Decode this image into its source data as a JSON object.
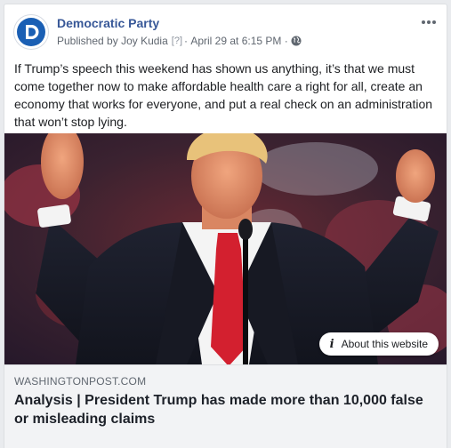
{
  "post": {
    "page_name": "Democratic Party",
    "published_prefix": "Published by",
    "author": "Joy Kudia",
    "help_marker": "[?]",
    "separator": "·",
    "timestamp": "April 29 at 6:15 PM",
    "audience_icon": "globe-icon",
    "more_icon": "more-options-icon",
    "text": "If Trump’s speech this weekend has shown us anything, it’s that we must come together now to make affordable health care a right for all, create an economy that works for everyone, and put a real check on an administration that won’t stop lying."
  },
  "link_preview": {
    "image_icon": "article-photo",
    "about_button_label": "About this website",
    "about_icon": "info-icon",
    "domain": "WASHINGTONPOST.COM",
    "headline": "Analysis | President Trump has made more than 10,000 false or misleading claims"
  },
  "colors": {
    "page_name": "#385898",
    "brand_blue": "#1a5fb4",
    "meta_text": "#606770",
    "caption_bg": "#f2f3f5"
  }
}
